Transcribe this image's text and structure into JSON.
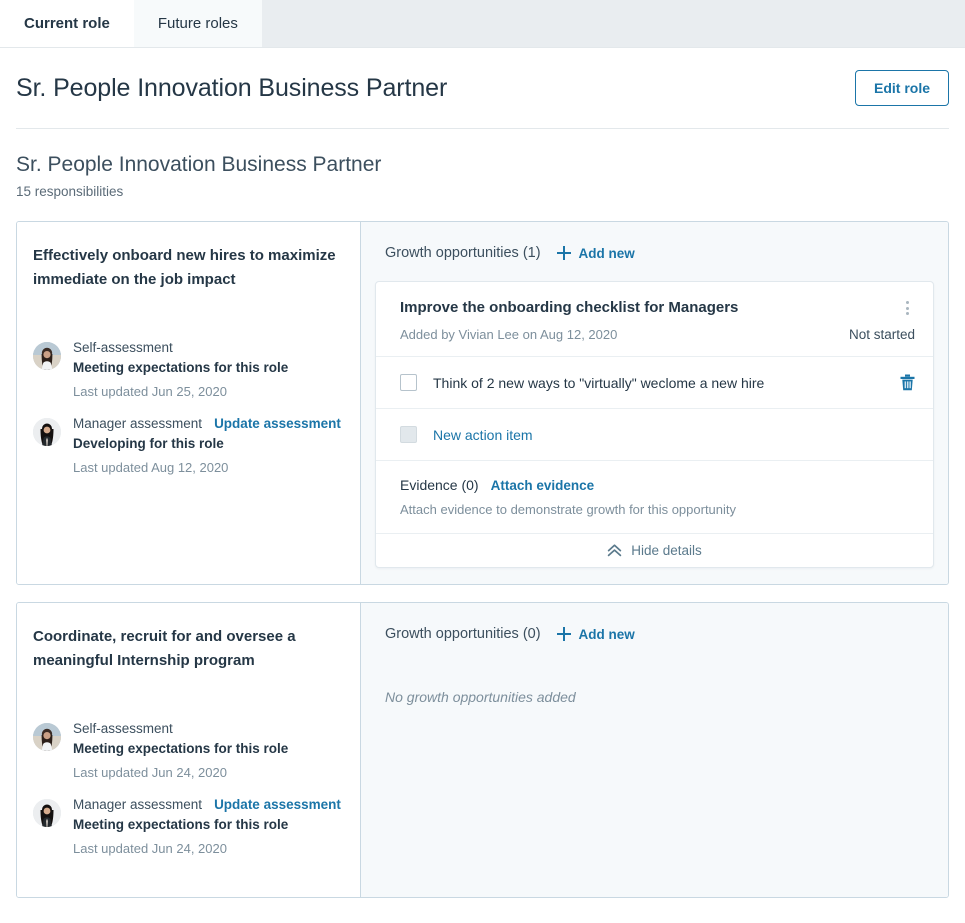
{
  "tabs": [
    {
      "label": "Current role",
      "active": true
    },
    {
      "label": "Future roles",
      "active": false
    }
  ],
  "header": {
    "role_title": "Sr. People Innovation Business Partner",
    "edit_button": "Edit role"
  },
  "section": {
    "title": "Sr. People Innovation Business Partner",
    "subtitle": "15 responsibilities"
  },
  "colors": {
    "link": "#1b75a8",
    "text": "#253746",
    "muted": "#7d8f9c",
    "panel_bg": "#f6f9fb",
    "card_border": "#c9d8e2"
  },
  "responsibilities": [
    {
      "name": "Effectively onboard new hires to maximize immediate on the job impact",
      "assessments": [
        {
          "label": "Self-assessment",
          "action_link": "",
          "level": "Meeting expectations for this role",
          "date": "Last updated Jun 25, 2020",
          "avatar": "avatar-self"
        },
        {
          "label": "Manager assessment",
          "action_link": "Update assessment",
          "level": "Developing for this role",
          "date": "Last updated Aug 12, 2020",
          "avatar": "avatar-manager"
        }
      ],
      "growth": {
        "title": "Growth opportunities (1)",
        "add_label": "Add new",
        "empty_text": "",
        "opportunities": [
          {
            "title": "Improve the onboarding checklist for Managers",
            "meta": "Added by Vivian Lee on Aug 12, 2020",
            "status": "Not started",
            "action_items": [
              {
                "text": "Think of 2 new ways to \"virtually\" weclome a new hire",
                "checked": false,
                "disabled": false,
                "is_link": false,
                "has_delete": true
              },
              {
                "text": "New action item",
                "checked": false,
                "disabled": true,
                "is_link": true,
                "has_delete": false
              }
            ],
            "evidence_label": "Evidence (0)",
            "evidence_link": "Attach evidence",
            "evidence_hint": "Attach evidence to demonstrate growth for this opportunity",
            "footer_label": "Hide details"
          }
        ]
      }
    },
    {
      "name": "Coordinate, recruit for and oversee a meaningful Internship program",
      "assessments": [
        {
          "label": "Self-assessment",
          "action_link": "",
          "level": "Meeting expectations for this role",
          "date": "Last updated Jun 24, 2020",
          "avatar": "avatar-self"
        },
        {
          "label": "Manager assessment",
          "action_link": "Update assessment",
          "level": "Meeting expectations for this role",
          "date": "Last updated Jun 24, 2020",
          "avatar": "avatar-manager"
        }
      ],
      "growth": {
        "title": "Growth opportunities (0)",
        "add_label": "Add new",
        "empty_text": "No growth opportunities added",
        "opportunities": []
      }
    }
  ]
}
